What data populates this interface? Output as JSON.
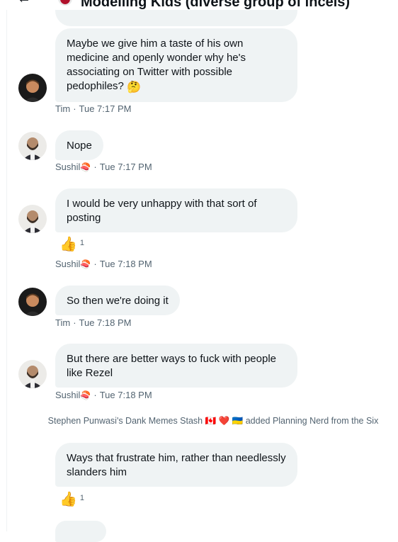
{
  "header": {
    "back_icon": "←",
    "title": "Modelling Kids (diverse group of incels)"
  },
  "messages": [
    {
      "text": "Maybe we give him a taste of his own medicine and openly wonder why he's associating on Twitter with possible pedophiles?",
      "emoji": "🤔",
      "sender": "Tim",
      "time": "Tue 7:17 PM"
    },
    {
      "text": "Nope",
      "sender": "Sushil",
      "sender_emoji": "🍣",
      "time": "Tue 7:17 PM"
    },
    {
      "text": "I would be very unhappy with that sort of posting",
      "reaction": {
        "emoji": "👍",
        "count": "1"
      },
      "sender": "Sushil",
      "sender_emoji": "🍣",
      "time": "Tue 7:18 PM"
    },
    {
      "text": "So then we're doing it",
      "sender": "Tim",
      "time": "Tue 7:18 PM"
    },
    {
      "text": "But there are better ways to fuck with people like Rezel",
      "sender": "Sushil",
      "sender_emoji": "🍣",
      "time": "Tue 7:18 PM"
    },
    {
      "text": "Ways that frustrate him, rather than needlessly slanders him",
      "reaction": {
        "emoji": "👍",
        "count": "1"
      }
    }
  ],
  "system": {
    "text": "Stephen Punwasi's Dank Memes Stash 🇨🇦 ❤️ 🇺🇦 added Planning Nerd from the Six"
  },
  "separator": "·"
}
